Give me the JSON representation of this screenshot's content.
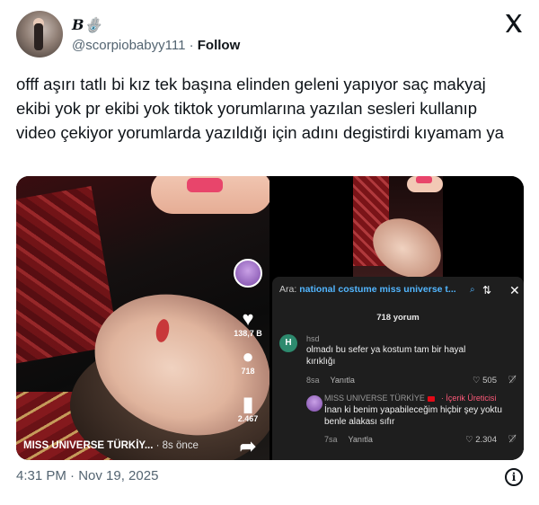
{
  "author": {
    "display_name": "B🪬",
    "handle": "@scorpiobabyy111",
    "separator": " · ",
    "follow_label": "Follow"
  },
  "tweet": {
    "text": "offf aşırı tatlı bi kız tek başına elinden geleni yapıyor saç makyaj ekibi yok pr ekibi yok tiktok yorumlarına yazılan sesleri kullanıp video çekiyor yorumlarda yazıldığı için adını degistirdi kıyamam ya",
    "timestamp": "4:31 PM · Nov 19, 2025"
  },
  "video_left": {
    "like_count": "138,7 B",
    "comment_count": "718",
    "save_count": "2.467",
    "caption_user": "MISS UNIVERSE TÜRKİY...",
    "caption_time": " · 8s önce"
  },
  "comments_panel": {
    "search_prefix": "Ara: ",
    "search_term": "national costume miss universe t...",
    "count_label": "718 yorum",
    "comments": [
      {
        "avatar_letter": "H",
        "user": "hsd",
        "text": "olmadı bu sefer ya kostum tam bir hayal kırıklığı",
        "age": "8sa",
        "reply_label": "Yanıtla",
        "likes": "505"
      },
      {
        "user": "MISS UNIVERSE TÜRKİYE",
        "creator_tag": "İçerik Üreticisi",
        "text": "İnan ki benim yapabileceğim hiçbir şey yoktu benle alakası sıfır",
        "age": "7sa",
        "reply_label": "Yanıtla",
        "likes": "2.304"
      }
    ]
  },
  "colors": {
    "accent_link": "#52b6ff",
    "panel_bg": "#1e1e1e",
    "creator_tag": "#ff5a7a"
  }
}
